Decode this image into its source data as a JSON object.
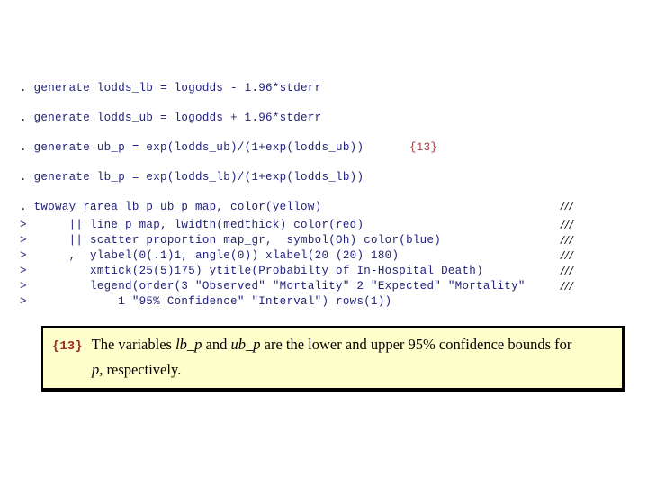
{
  "slide": {
    "background_color": "#ffffff",
    "code_color": "#21217a",
    "marker_color": "#000000",
    "ref_color": "#9e3b3b",
    "callout_bg": "#ffffcc",
    "callout_border": "#000000",
    "callout_num_color": "#9e2b2b"
  },
  "console": {
    "continuation_marker": "///",
    "lines": [
      {
        "text": ". generate lodds_lb = logodds - 1.96*stderr",
        "marker": "",
        "ref": ""
      },
      {
        "text": ". generate lodds_ub = logodds + 1.96*stderr",
        "marker": "",
        "ref": ""
      },
      {
        "text": ". generate ub_p = exp(lodds_ub)/(1+exp(lodds_ub))",
        "marker": "",
        "ref": "{13}"
      },
      {
        "text": ". generate lb_p = exp(lodds_lb)/(1+exp(lodds_lb))",
        "marker": "",
        "ref": ""
      },
      {
        "text": ". twoway rarea lb_p ub_p map, color(yellow)",
        "marker": "///",
        "ref": ""
      },
      {
        "text": ">      || line p map, lwidth(medthick) color(red)",
        "marker": "///",
        "ref": ""
      },
      {
        "text": ">      || scatter proportion map_gr,  symbol(Oh) color(blue)",
        "marker": "///",
        "ref": ""
      },
      {
        "text": ">      ,  ylabel(0(.1)1, angle(0)) xlabel(20 (20) 180)",
        "marker": "///",
        "ref": ""
      },
      {
        "text": ">         xmtick(25(5)175) ytitle(Probabilty of In-Hospital Death)",
        "marker": "///",
        "ref": ""
      },
      {
        "text": ">         legend(order(3 \"Observed\" \"Mortality\" 2 \"Expected\" \"Mortality\"",
        "marker": "///",
        "ref": ""
      },
      {
        "text": ">             1 \"95% Confidence\" \"Interval\") rows(1))",
        "marker": "",
        "ref": ""
      }
    ]
  },
  "callout": {
    "number": "{13}",
    "text_part1": "The variables ",
    "var1": "lb_p",
    "text_part2": " and ",
    "var2": "ub_p",
    "text_part3": " are the lower and upper 95% confidence bounds for",
    "var3": "p",
    "text_part4": ", respectively."
  }
}
